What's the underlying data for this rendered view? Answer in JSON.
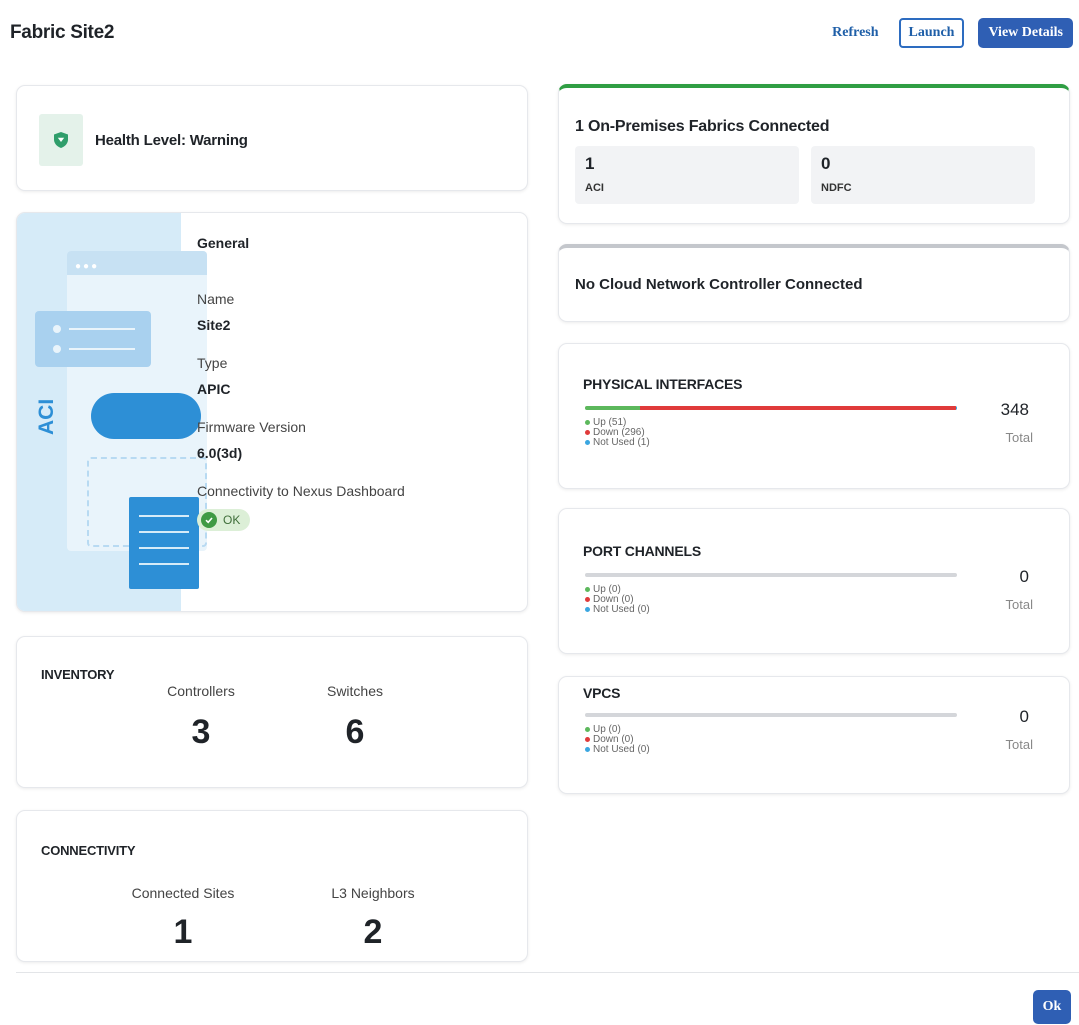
{
  "header": {
    "title": "Fabric Site2",
    "refresh_label": "Refresh",
    "launch_label": "Launch",
    "view_details_label": "View Details"
  },
  "health": {
    "text": "Health Level: Warning",
    "icon": "shield-icon",
    "icon_color": "#2f9e6b"
  },
  "general": {
    "illustration_label": "ACI",
    "title": "General",
    "name_label": "Name",
    "name_value": "Site2",
    "type_label": "Type",
    "type_value": "APIC",
    "firmware_label": "Firmware Version",
    "firmware_value": "6.0(3d)",
    "connectivity_label": "Connectivity to Nexus Dashboard",
    "connectivity_status": "OK"
  },
  "inventory": {
    "title": "INVENTORY",
    "controllers_label": "Controllers",
    "controllers_value": "3",
    "switches_label": "Switches",
    "switches_value": "6"
  },
  "connectivity": {
    "title": "CONNECTIVITY",
    "sites_label": "Connected Sites",
    "sites_value": "1",
    "neighbors_label": "L3 Neighbors",
    "neighbors_value": "2"
  },
  "onprem": {
    "title": "1 On-Premises Fabrics Connected",
    "aci_value": "1",
    "aci_label": "ACI",
    "ndfc_value": "0",
    "ndfc_label": "NDFC",
    "accent": "#2f9e43"
  },
  "cloud": {
    "title": "No Cloud Network Controller Connected"
  },
  "physical": {
    "title": "PHYSICAL INTERFACES",
    "up": "Up (51)",
    "down": "Down (296)",
    "not_used": "Not Used (1)",
    "total_value": "348",
    "total_label": "Total",
    "up_fraction": 0.147,
    "down_fraction": 0.85,
    "not_used_fraction": 0.003
  },
  "port_channels": {
    "title": "PORT CHANNELS",
    "up": "Up (0)",
    "down": "Down (0)",
    "not_used": "Not Used (0)",
    "total_value": "0",
    "total_label": "Total"
  },
  "vpcs": {
    "title": "VPCS",
    "up": "Up (0)",
    "down": "Down (0)",
    "not_used": "Not Used (0)",
    "total_value": "0",
    "total_label": "Total"
  },
  "colors": {
    "up": "#5cb85c",
    "down": "#e03a3a",
    "not_used": "#3aa6e0",
    "primary": "#2f5fb4"
  },
  "footer": {
    "ok_label": "Ok"
  }
}
